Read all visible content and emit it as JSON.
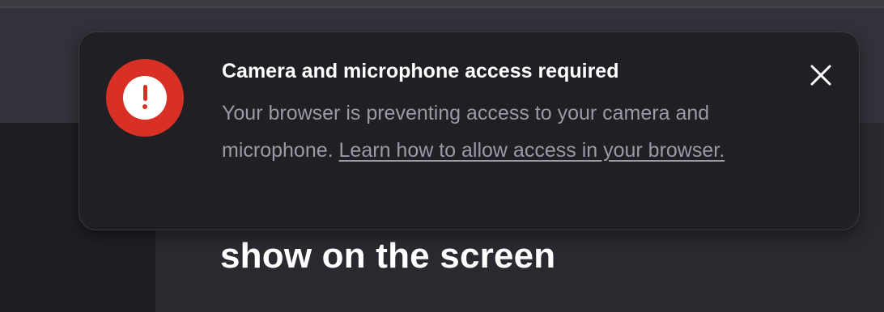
{
  "notification": {
    "title": "Camera and microphone access required",
    "message": "Your browser is preventing access to your camera and microphone. ",
    "link_text": "Learn how to allow access in your browser.",
    "alert_icon": "exclamation-circle-icon",
    "close_icon": "close-icon",
    "accent_color": "#d93025"
  },
  "main": {
    "heading": "show on the screen"
  }
}
